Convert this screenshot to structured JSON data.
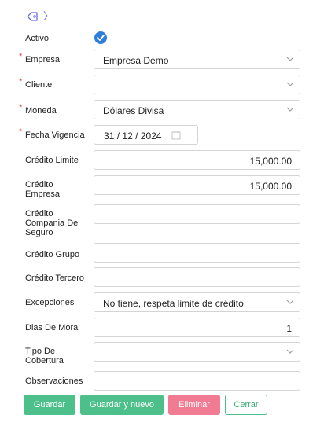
{
  "toolbar": {
    "tag_icon": "tag-icon",
    "nav_icon": "chevron-right-icon",
    "nav_glyph": "〉"
  },
  "form": {
    "activo": {
      "label": "Activo",
      "checked": true
    },
    "empresa": {
      "label": "Empresa",
      "required": true,
      "value": "Empresa Demo"
    },
    "cliente": {
      "label": "Cliente",
      "required": true,
      "value": ""
    },
    "moneda": {
      "label": "Moneda",
      "required": true,
      "value": "Dólares Divisa"
    },
    "fecha_vigencia": {
      "label": "Fecha Vigencia",
      "required": true,
      "day": "31",
      "month": "12",
      "year": "2024",
      "sep": "/"
    },
    "credito_limite": {
      "label": "Crédito Limite",
      "value": "15,000.00"
    },
    "credito_empresa": {
      "label_line1": "Crédito",
      "label_line2": "Empresa",
      "value": "15,000.00"
    },
    "credito_compania": {
      "label_line1": "Crédito",
      "label_line2": "Compania De",
      "label_line3": "Seguro",
      "value": ""
    },
    "credito_grupo": {
      "label": "Crédito Grupo",
      "value": ""
    },
    "credito_tercero": {
      "label": "Crédito Tercero",
      "value": ""
    },
    "excepciones": {
      "label": "Excepciones",
      "value": "No tiene, respeta limite de crédito"
    },
    "dias_mora": {
      "label": "Dias De Mora",
      "value": "1"
    },
    "tipo_cobertura": {
      "label_line1": "Tipo De",
      "label_line2": "Cobertura",
      "value": ""
    },
    "observaciones": {
      "label": "Observaciones",
      "value": ""
    }
  },
  "required_marker": "*",
  "buttons": {
    "guardar": "Guardar",
    "guardar_nuevo": "Guardar y nuevo",
    "eliminar": "Eliminar",
    "cerrar": "Cerrar"
  },
  "colors": {
    "accent": "#4cbf8a",
    "danger": "#f07b93",
    "required": "#e53935",
    "check": "#2f7fd9"
  }
}
